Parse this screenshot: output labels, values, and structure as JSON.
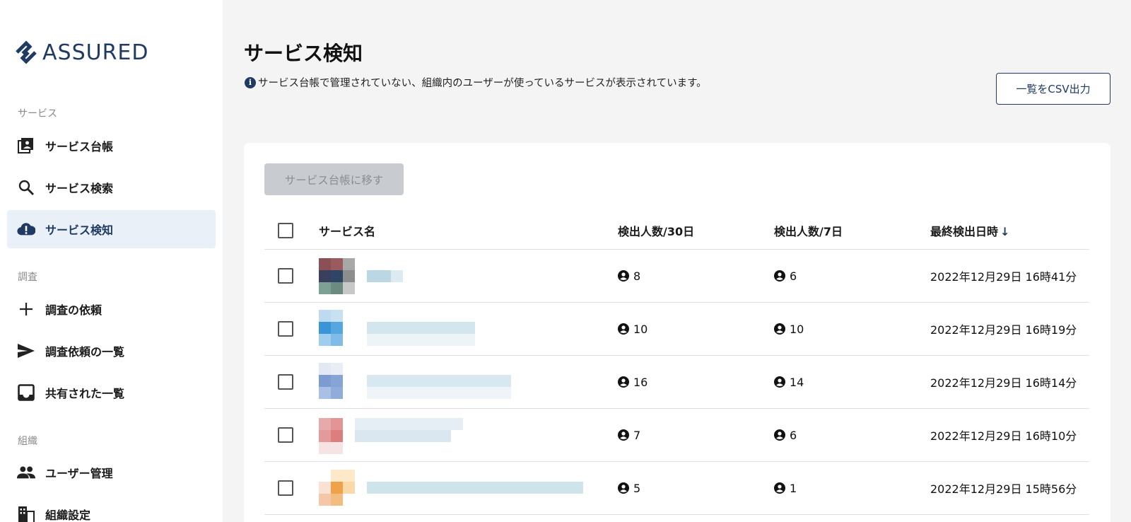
{
  "sidebar": {
    "logo_text": "ASSURED",
    "sections": [
      {
        "label": "サービス"
      },
      {
        "label": "調査"
      },
      {
        "label": "組織"
      }
    ],
    "items": [
      {
        "label": "サービス台帳",
        "icon": "ledger-icon"
      },
      {
        "label": "サービス検索",
        "icon": "search-icon"
      },
      {
        "label": "サービス検知",
        "icon": "cloud-alert-icon",
        "active": true
      },
      {
        "label": "調査の依頼",
        "icon": "plus-icon"
      },
      {
        "label": "調査依頼の一覧",
        "icon": "send-icon"
      },
      {
        "label": "共有された一覧",
        "icon": "inbox-icon"
      },
      {
        "label": "ユーザー管理",
        "icon": "people-icon"
      },
      {
        "label": "組織設定",
        "icon": "building-icon"
      }
    ]
  },
  "main": {
    "title": "サービス検知",
    "description": "サービス台帳で管理されていない、組織内のユーザーが使っているサービスが表示されています。",
    "csv_button": "一覧をCSV出力",
    "move_button": "サービス台帳に移す",
    "table": {
      "headers": {
        "name": "サービス名",
        "count30": "検出人数/30日",
        "count7": "検出人数/7日",
        "last": "最終検出日時",
        "sort_arrow": "↓"
      },
      "rows": [
        {
          "count30": "8",
          "count7": "6",
          "last": "2022年12月29日 16時41分"
        },
        {
          "count30": "10",
          "count7": "10",
          "last": "2022年12月29日 16時19分"
        },
        {
          "count30": "16",
          "count7": "14",
          "last": "2022年12月29日 16時14分"
        },
        {
          "count30": "7",
          "count7": "6",
          "last": "2022年12月29日 16時10分"
        },
        {
          "count30": "5",
          "count7": "1",
          "last": "2022年12月29日 15時56分"
        }
      ]
    }
  },
  "colors": {
    "brand": "#1f3b63",
    "active_bg": "#eaf0f8",
    "disabled_button": "#c8ccd0"
  }
}
